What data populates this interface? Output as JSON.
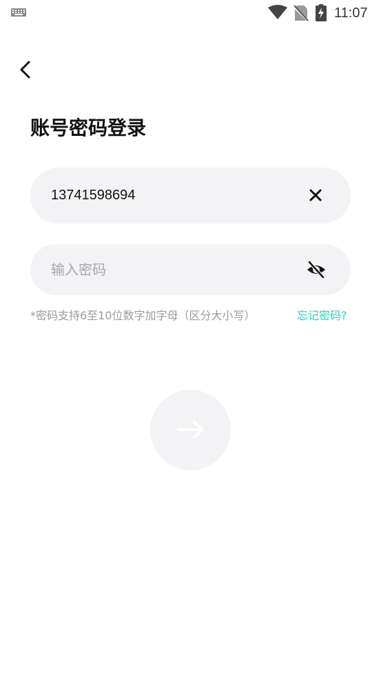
{
  "status_bar": {
    "time": "11:07",
    "icons": [
      "keyboard-icon",
      "wifi-icon",
      "no-sim-icon",
      "battery-charging-icon"
    ]
  },
  "header": {
    "back_icon": "chevron-left-icon",
    "title": "账号密码登录"
  },
  "form": {
    "phone": {
      "value": "13741598694",
      "clear_icon": "close-icon"
    },
    "password": {
      "value": "",
      "placeholder": "输入密码",
      "visibility_icon": "eye-off-icon"
    },
    "hint": "*密码支持6至10位数字加字母（区分大小写）",
    "forgot_label": "忘记密码?",
    "submit_icon": "arrow-right-icon"
  },
  "colors": {
    "accent": "#21d4bd",
    "field_bg": "#f3f3f5",
    "hint": "#9a9a9e"
  }
}
